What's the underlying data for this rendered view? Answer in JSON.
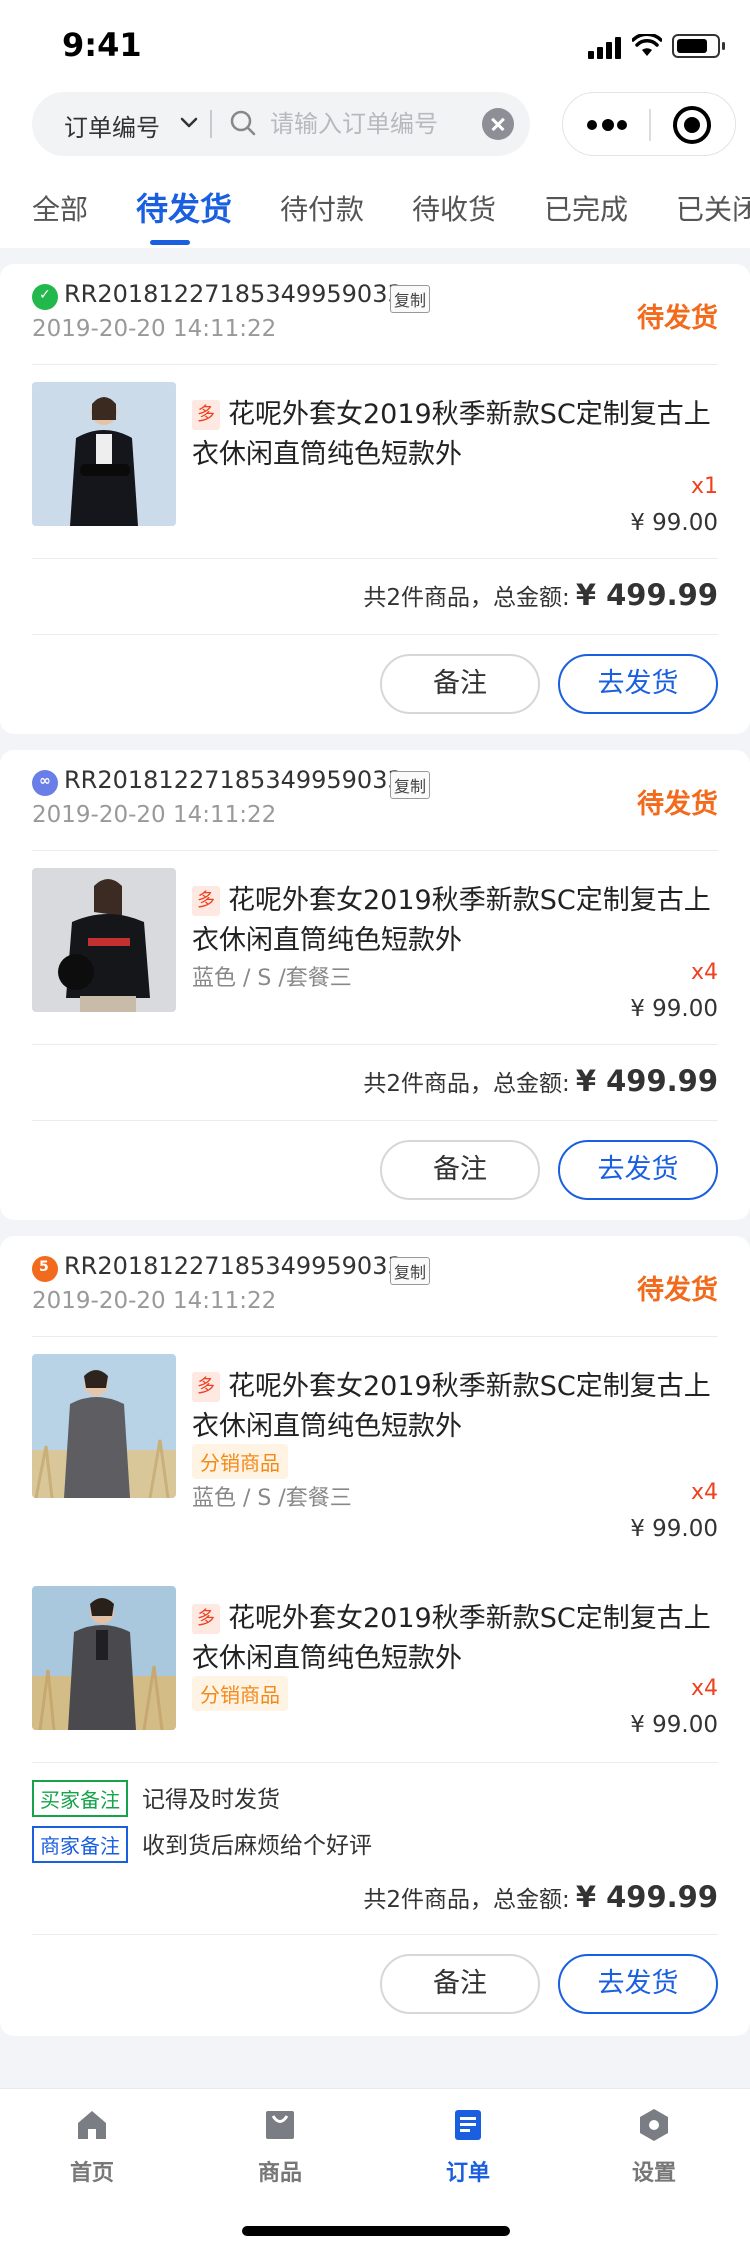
{
  "status_bar": {
    "time": "9:41"
  },
  "search": {
    "select_label": "订单编号",
    "placeholder": "请输入订单编号"
  },
  "tabs": [
    "全部",
    "待发货",
    "待付款",
    "待收货",
    "已完成",
    "已关闭"
  ],
  "active_tab": "待发货",
  "common": {
    "copy_label": "复制",
    "multi_tag": "多",
    "distribution_tag": "分销商品",
    "note_button": "备注",
    "ship_button": "去发货"
  },
  "orders": [
    {
      "source_icon": "wechat-icon",
      "order_no": "RR20181227185349959033",
      "time": "2019-20-20 14:11:22",
      "status": "待发货",
      "items": [
        {
          "name": "花呢外套女2019秋季新款SC定制复古上衣休闲直筒纯色短款外",
          "qty": "x1",
          "price": "¥ 99.00"
        }
      ],
      "summary_label": "共2件商品，总金额:",
      "total": "¥ 499.99"
    },
    {
      "source_icon": "mini-program-icon",
      "order_no": "RR20181227185349959033",
      "time": "2019-20-20 14:11:22",
      "status": "待发货",
      "items": [
        {
          "name": "花呢外套女2019秋季新款SC定制复古上衣休闲直筒纯色短款外",
          "spec": "蓝色 / S /套餐三",
          "qty": "x4",
          "price": "¥ 99.00"
        }
      ],
      "summary_label": "共2件商品，总金额:",
      "total": "¥ 499.99"
    },
    {
      "source_icon": "h5-icon",
      "order_no": "RR20181227185349959033",
      "time": "2019-20-20 14:11:22",
      "status": "待发货",
      "items": [
        {
          "name": "花呢外套女2019秋季新款SC定制复古上衣休闲直筒纯色短款外",
          "spec": "蓝色 / S /套餐三",
          "qty": "x4",
          "price": "¥ 99.00"
        },
        {
          "name": "花呢外套女2019秋季新款SC定制复古上衣休闲直筒纯色短款外",
          "qty": "x4",
          "price": "¥ 99.00"
        }
      ],
      "buyer_remark": {
        "label": "买家备注",
        "text": "记得及时发货"
      },
      "seller_remark": {
        "label": "商家备注",
        "text": "收到货后麻烦给个好评"
      },
      "summary_label": "共2件商品，总金额:",
      "total": "¥ 499.99"
    }
  ],
  "bottom_nav": [
    {
      "label": "首页",
      "icon": "home-icon"
    },
    {
      "label": "商品",
      "icon": "bag-icon"
    },
    {
      "label": "订单",
      "icon": "order-doc-icon"
    },
    {
      "label": "设置",
      "icon": "settings-hex-icon"
    }
  ],
  "active_nav": "订单",
  "colors": {
    "accent": "#1a5fe0",
    "status_orange": "#f26a1b",
    "price_red": "#f0401e",
    "buyer_green": "#17a34a"
  }
}
